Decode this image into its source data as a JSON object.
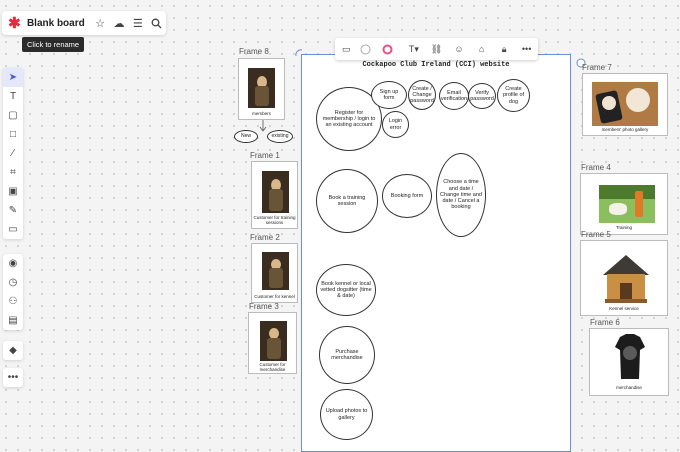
{
  "board": {
    "title": "Blank board",
    "tooltip": "Click to rename"
  },
  "main_frame": {
    "title": "Cockapoo Club Ireland (CCI) website",
    "ovals": [
      {
        "text": "Register for membership / login to an existing account"
      },
      {
        "text": "Sign up form"
      },
      {
        "text": "Create / Change password"
      },
      {
        "text": "Email verification"
      },
      {
        "text": "Verify password"
      },
      {
        "text": "Create profile of dog"
      },
      {
        "text": "Login error"
      },
      {
        "text": "Book a training session"
      },
      {
        "text": "Booking form"
      },
      {
        "text": "Choose a time and date / Change time and date / Cancel a booking"
      },
      {
        "text": "Book kennel or local vetted dogsitter (time & date)"
      },
      {
        "text": "Purchase merchandise"
      },
      {
        "text": "Upload photos to gallery"
      }
    ]
  },
  "frames": {
    "frame8": {
      "label": "Frame 8",
      "caption": "members",
      "choices": [
        "New",
        "existing"
      ]
    },
    "frame1": {
      "label": "Frame 1",
      "caption": "Customer for training sessions"
    },
    "frame2": {
      "label": "Frame 2",
      "caption": "Customer for kennel"
    },
    "frame3": {
      "label": "Frame 3",
      "caption": "Customer for merchandise"
    },
    "frame7": {
      "label": "Frame 7",
      "caption": "members' photo gallery"
    },
    "frame4": {
      "label": "Frame 4",
      "caption": "Training"
    },
    "frame5": {
      "label": "Frame 5",
      "caption": "Kennel service"
    },
    "frame6": {
      "label": "Frame 6",
      "caption": "merchandise"
    }
  },
  "icons": {
    "boardbar": [
      "star-icon",
      "cloud-icon",
      "menu-icon",
      "search-icon"
    ],
    "toolbar": [
      "select-icon",
      "text-icon",
      "sticky-note-icon",
      "rectangle-icon",
      "pen-icon",
      "frame-icon",
      "image-icon",
      "comment-icon",
      "template-icon"
    ],
    "context": [
      "rectangle-shape-icon",
      "fill-color-icon",
      "border-color-icon",
      "text-style-icon",
      "link-icon",
      "emoji-icon",
      "tag-icon",
      "lock-icon",
      "more-icon"
    ]
  },
  "colors": {
    "brand": "#e8283c",
    "selection": "#6b8ed6",
    "accent": "#e8508a"
  }
}
